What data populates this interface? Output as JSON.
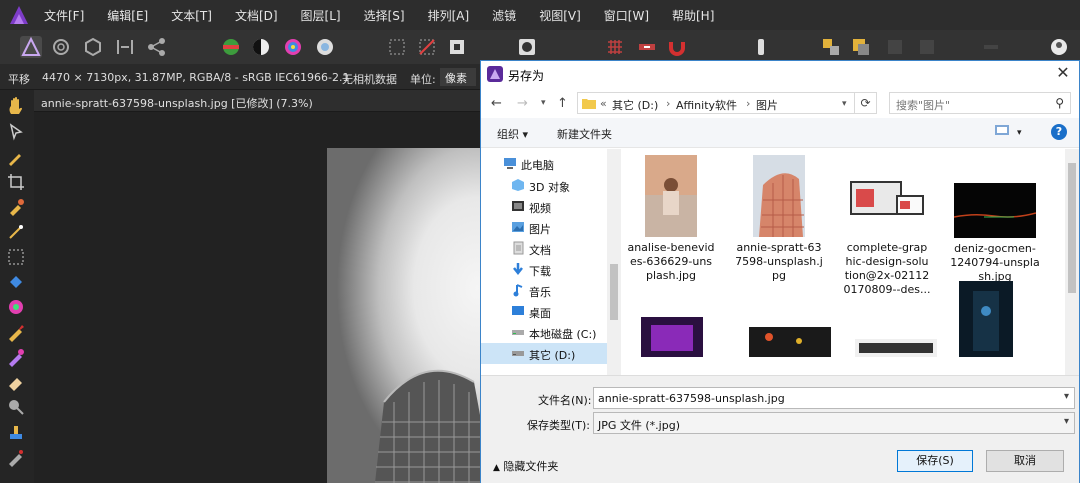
{
  "app": {
    "menus": [
      "文件[F]",
      "编辑[E]",
      "文本[T]",
      "文档[D]",
      "图层[L]",
      "选择[S]",
      "排列[A]",
      "滤镜",
      "视图[V]",
      "窗口[W]",
      "帮助[H]"
    ]
  },
  "context": {
    "tool": "平移",
    "info": "4470 × 7130px, 31.87MP, RGBA/8 - sRGB IEC61966-2.1",
    "camera": "无相机数据",
    "unit_label": "单位:",
    "unit_value": "像素"
  },
  "document": {
    "tab_title": "annie-spratt-637598-unsplash.jpg [已修改] (7.3%)"
  },
  "dialog": {
    "title": "另存为",
    "path": {
      "prefix": "«",
      "crumbs": [
        "其它 (D:)",
        "Affinity软件",
        "图片"
      ]
    },
    "search_placeholder": "搜索\"图片\"",
    "organize": "组织 ▾",
    "new_folder": "新建文件夹",
    "tree": [
      "此电脑",
      "3D 对象",
      "视频",
      "图片",
      "文档",
      "下载",
      "音乐",
      "桌面",
      "本地磁盘 (C:)",
      "其它 (D:)"
    ],
    "files": [
      {
        "name": "analise-benevid es-636629-uns plash.jpg"
      },
      {
        "name": "annie-spratt-63 7598-unsplash.j pg"
      },
      {
        "name": "complete-grap hic-design-solu tion@2x-02112 0170809--des..."
      },
      {
        "name": "deniz-gocmen- 1240794-unspla sh.jpg"
      }
    ],
    "filename_label": "文件名(N):",
    "filename_value": "annie-spratt-637598-unsplash.jpg",
    "filetype_label": "保存类型(T):",
    "filetype_value": "JPG 文件 (*.jpg)",
    "hide_folders": "隐藏文件夹",
    "save": "保存(S)",
    "cancel": "取消"
  },
  "colors": {
    "accent": "#0078d7",
    "app_bg": "#1e1e1e",
    "affinity_purple": "#7d3cc8"
  }
}
